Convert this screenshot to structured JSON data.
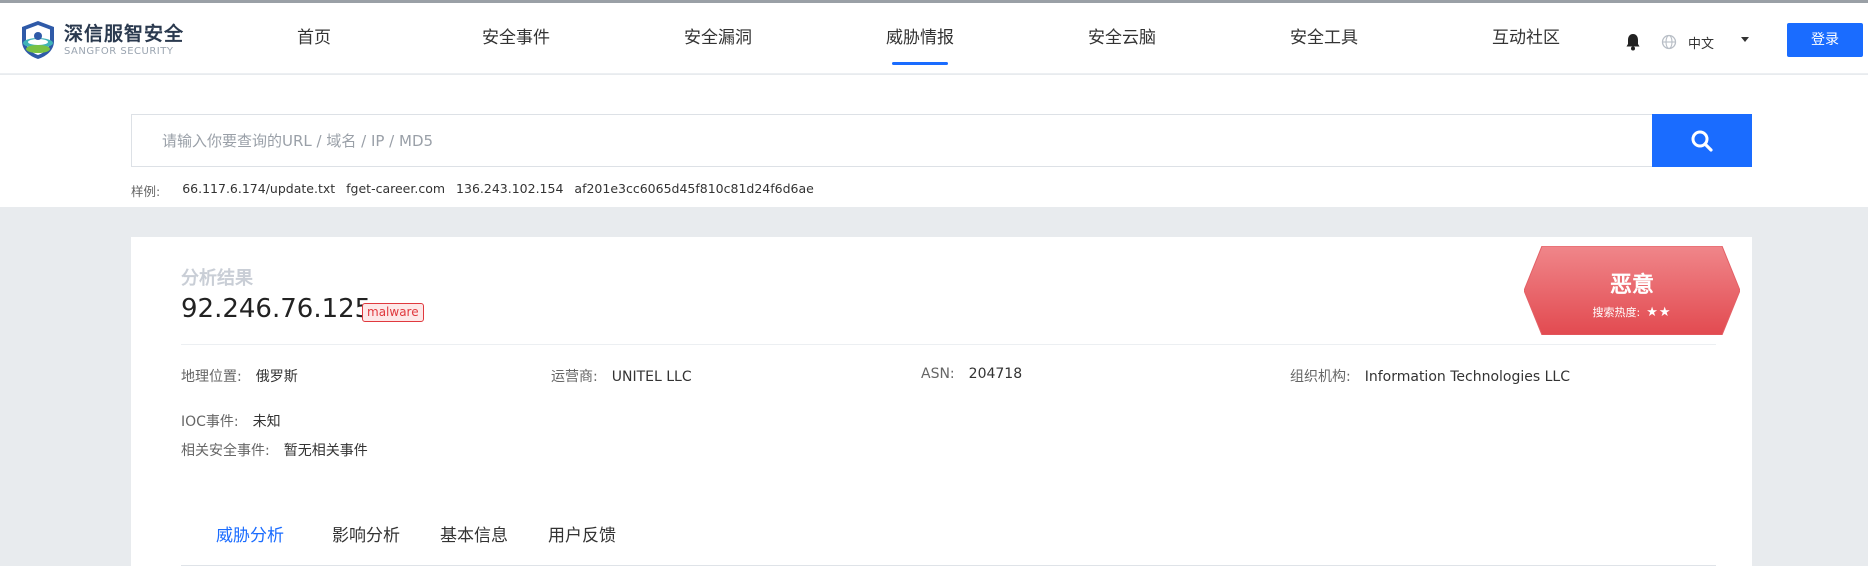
{
  "header": {
    "logo_cn": "深信服智安全",
    "logo_en": "SANGFOR SECURITY",
    "nav": [
      {
        "label": "首页",
        "active": false
      },
      {
        "label": "安全事件",
        "active": false
      },
      {
        "label": "安全漏洞",
        "active": false
      },
      {
        "label": "威胁情报",
        "active": true
      },
      {
        "label": "安全云脑",
        "active": false
      },
      {
        "label": "安全工具",
        "active": false
      },
      {
        "label": "互动社区",
        "active": false
      }
    ],
    "language": "中文",
    "login_label": "登录",
    "icons": [
      "bell-icon",
      "globe-icon",
      "chevron-down-icon"
    ]
  },
  "search": {
    "placeholder": "请输入你要查询的URL / 域名 / IP / MD5",
    "value": "",
    "samples_label": "样例:",
    "samples": [
      "66.117.6.174/update.txt",
      "fget-career.com",
      "136.243.102.154",
      "af201e3cc6065d45f810c81d24f6d6ae"
    ],
    "button_icon": "search-icon"
  },
  "result": {
    "section_label": "分析结果",
    "ip": "92.246.76.125",
    "tag": "malware",
    "verdict": "恶意",
    "heat_label": "搜索热度:",
    "heat_stars": "★★",
    "geo_label": "地理位置:",
    "geo_value": "俄罗斯",
    "isp_label": "运营商:",
    "isp_value": "UNITEL LLC",
    "asn_label": "ASN:",
    "asn_value": "204718",
    "org_label": "组织机构:",
    "org_value": "Information Technologies LLC",
    "ioc_label": "IOC事件:",
    "ioc_value": "未知",
    "related_label": "相关安全事件:",
    "related_value": "暂无相关事件"
  },
  "tabs": [
    {
      "label": "威胁分析",
      "active": true
    },
    {
      "label": "影响分析",
      "active": false
    },
    {
      "label": "基本信息",
      "active": false
    },
    {
      "label": "用户反馈",
      "active": false
    }
  ],
  "colors": {
    "brand_blue": "#1a6cff",
    "malicious_red": "#e9555a"
  }
}
